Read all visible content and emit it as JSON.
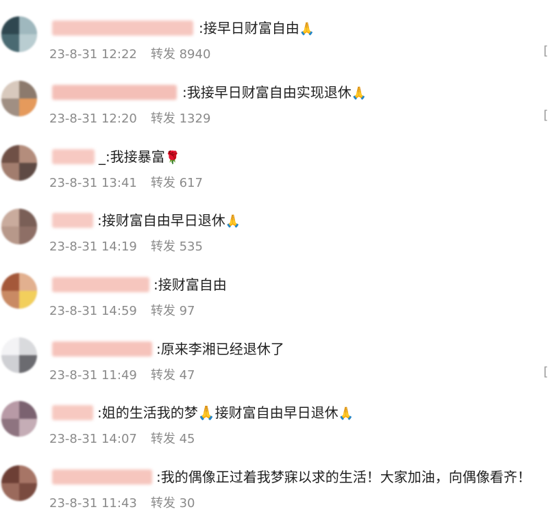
{
  "colors": {
    "text": "#1f1f1f",
    "meta": "#8a8a8a",
    "name_blur": "#f6c7c0"
  },
  "comments": [
    {
      "content": ":接早日财富自由",
      "emoji": "🙏",
      "date": "23-8-31 12:22",
      "repost_label": "转发",
      "repost_count": "8940",
      "bracket": "["
    },
    {
      "content": ":我接早日财富自由实现退休",
      "emoji": "🙏",
      "date": "23-8-31 12:20",
      "repost_label": "转发",
      "repost_count": "1329",
      "bracket": "["
    },
    {
      "content": "_:我接暴富",
      "emoji": "🌹",
      "date": "23-8-31 13:41",
      "repost_label": "转发",
      "repost_count": "617",
      "bracket": ""
    },
    {
      "content": ":接财富自由早日退休",
      "emoji": "🙏",
      "date": "23-8-31 14:19",
      "repost_label": "转发",
      "repost_count": "535",
      "bracket": ""
    },
    {
      "content": ":接财富自由",
      "emoji": "",
      "date": "23-8-31 14:59",
      "repost_label": "转发",
      "repost_count": "97",
      "bracket": ""
    },
    {
      "content": ":原来李湘已经退休了",
      "emoji": "",
      "date": "23-8-31 11:49",
      "repost_label": "转发",
      "repost_count": "47",
      "bracket": "["
    },
    {
      "content": ":姐的生活我的梦🙏接财富自由早日退休",
      "emoji": "🙏",
      "date": "23-8-31 14:07",
      "repost_label": "转发",
      "repost_count": "45",
      "bracket": ""
    },
    {
      "content": ":我的偶像正过着我梦寐以求的生活！大家加油，向偶像看齐！",
      "emoji": "",
      "date": "23-8-31 11:43",
      "repost_label": "转发",
      "repost_count": "30",
      "bracket": ""
    }
  ]
}
